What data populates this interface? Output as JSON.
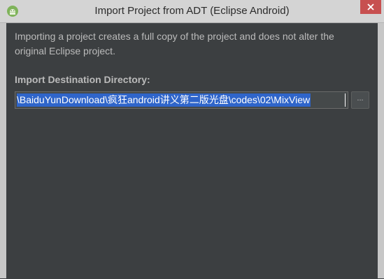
{
  "window": {
    "title": "Import Project from ADT (Eclipse Android)",
    "app_icon": "android-icon",
    "close_icon": "close-icon"
  },
  "content": {
    "description": "Importing a project creates a full copy of the project and does not alter the original Eclipse project.",
    "destination_label": "Import Destination Directory:",
    "destination_value": "\\BaiduYunDownload\\疯狂android讲义第二版光盘\\codes\\02\\MixView",
    "browse_label": "...",
    "browse_icon": "ellipsis-icon"
  },
  "colors": {
    "dialog_background": "#3c3f41",
    "title_bar": "#d4d4d4",
    "close_button": "#c75050",
    "selection": "#2f65ca",
    "text": "#bbbbbb"
  }
}
